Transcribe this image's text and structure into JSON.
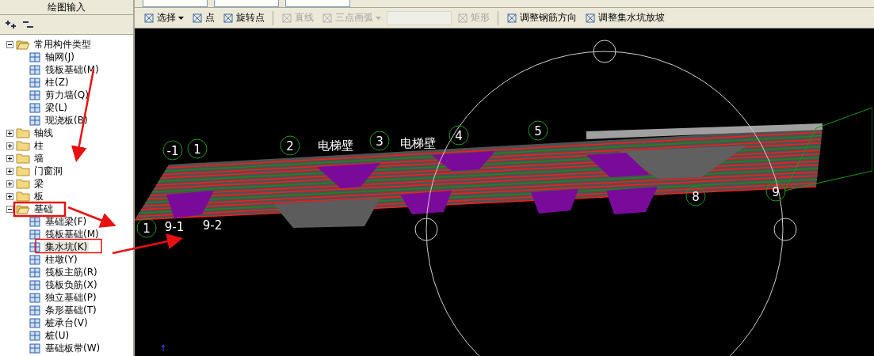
{
  "panel": {
    "title": "绘图输入"
  },
  "tree": [
    {
      "label": "常用构件类型",
      "expanded": true,
      "children": [
        {
          "label": "轴网(J)",
          "selected": false
        },
        {
          "label": "筏板基础(M)",
          "selected": false
        },
        {
          "label": "柱(Z)",
          "selected": false
        },
        {
          "label": "剪力墙(Q)",
          "selected": false
        },
        {
          "label": "梁(L)",
          "selected": false
        },
        {
          "label": "现浇板(B)",
          "selected": false
        }
      ]
    },
    {
      "label": "轴线",
      "expanded": false
    },
    {
      "label": "柱",
      "expanded": false
    },
    {
      "label": "墙",
      "expanded": false
    },
    {
      "label": "门窗洞",
      "expanded": false
    },
    {
      "label": "梁",
      "expanded": false
    },
    {
      "label": "板",
      "expanded": false
    },
    {
      "label": "基础",
      "expanded": true,
      "children": [
        {
          "label": "基础梁(F)",
          "selected": false
        },
        {
          "label": "筏板基础(M)",
          "selected": false
        },
        {
          "label": "集水坑(K)",
          "selected": true
        },
        {
          "label": "柱墩(Y)",
          "selected": false
        },
        {
          "label": "筏板主筋(R)",
          "selected": false
        },
        {
          "label": "筏板负筋(X)",
          "selected": false
        },
        {
          "label": "独立基础(P)",
          "selected": false
        },
        {
          "label": "条形基础(T)",
          "selected": false
        },
        {
          "label": "桩承台(V)",
          "selected": false
        },
        {
          "label": "桩(U)",
          "selected": false
        },
        {
          "label": "基础板带(W)",
          "selected": false
        }
      ]
    }
  ],
  "toolbar": [
    {
      "kind": "dropdown",
      "label": "选择",
      "disabled": false
    },
    {
      "kind": "button",
      "label": "点",
      "disabled": false
    },
    {
      "kind": "button",
      "label": "旋转点",
      "disabled": false
    },
    {
      "kind": "separator"
    },
    {
      "kind": "button",
      "label": "直线",
      "disabled": true
    },
    {
      "kind": "dropdown",
      "label": "三点画弧",
      "disabled": true
    },
    {
      "kind": "combo",
      "disabled": true
    },
    {
      "kind": "button",
      "label": "矩形",
      "disabled": true
    },
    {
      "kind": "separator"
    },
    {
      "kind": "button",
      "label": "调整钢筋方向",
      "disabled": false
    },
    {
      "kind": "button",
      "label": "调整集水坑放坡",
      "disabled": false
    }
  ],
  "canvas": {
    "labels": [
      {
        "text": "-1",
        "kind": "axis"
      },
      {
        "text": "1",
        "kind": "axis"
      },
      {
        "text": "2",
        "kind": "axis"
      },
      {
        "text": "电梯壁",
        "kind": "text"
      },
      {
        "text": "3",
        "kind": "axis"
      },
      {
        "text": "电梯壁",
        "kind": "text"
      },
      {
        "text": "4",
        "kind": "axis"
      },
      {
        "text": "5",
        "kind": "axis"
      },
      {
        "text": "1",
        "kind": "axis"
      },
      {
        "text": "9-1",
        "kind": "text"
      },
      {
        "text": "9-2",
        "kind": "text"
      },
      {
        "text": "8",
        "kind": "axis"
      },
      {
        "text": "9",
        "kind": "axis"
      }
    ]
  }
}
